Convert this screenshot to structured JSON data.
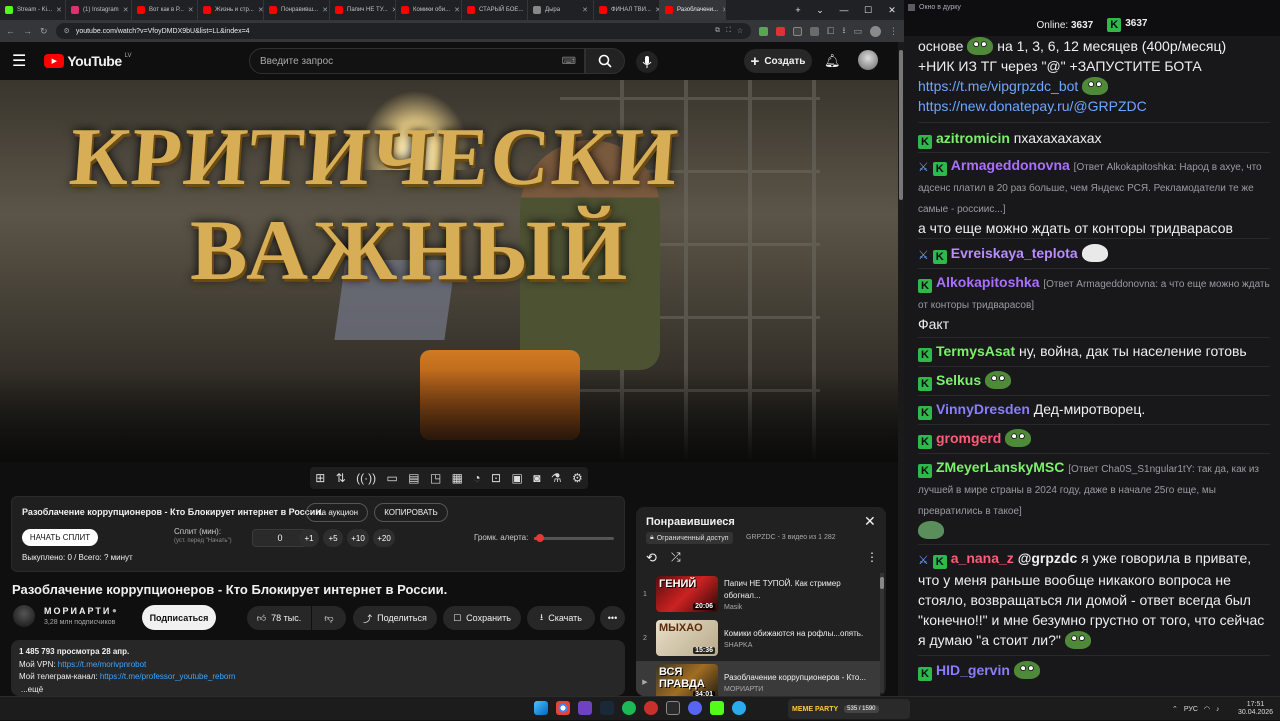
{
  "browser": {
    "tabs": [
      {
        "label": "Stream - Ki...",
        "color": "#53fc18"
      },
      {
        "label": "(1) Instagram",
        "color": "#e1306c"
      },
      {
        "label": "Вот как в Р...",
        "color": "#ff0000"
      },
      {
        "label": "Жизнь и стр...",
        "color": "#ff0000"
      },
      {
        "label": "Понравивш...",
        "color": "#ff0000"
      },
      {
        "label": "Папич НЕ ТУ...",
        "color": "#ff0000"
      },
      {
        "label": "Комики оби...",
        "color": "#ff0000"
      },
      {
        "label": "СТАРЫЙ БОЕ...",
        "color": "#ff0000"
      },
      {
        "label": "Дыра",
        "color": "#888888"
      },
      {
        "label": "ФИНАЛ ТВИ...",
        "color": "#ff0000"
      },
      {
        "label": "Разоблачени...",
        "color": "#ff0000",
        "active": true
      }
    ],
    "url": "youtube.com/watch?v=VfoyDMDX9bU&list=LL&index=4"
  },
  "youtube": {
    "logo": "YouTube",
    "region": "LV",
    "search_placeholder": "Введите запрос",
    "create_label": "Создать",
    "video_overlay_line1": "КРИТИЧЕСКИ",
    "video_overlay_line2": "ВАЖНЫЙ",
    "ext": {
      "title": "Разоблачение коррупционеров - Кто Блокирует интернет в России.",
      "auction_label": "На аукцион",
      "copy_label": "КОПИРОВАТЬ",
      "start_split_label": "НАЧАТЬ СПЛИТ",
      "split_label": "Сплит (мин):",
      "split_hint": "(уст. перед \"Начать\")",
      "split_value": "0",
      "inc": [
        "+1",
        "+5",
        "+10",
        "+20"
      ],
      "alert_volume_label": "Громк. алерта:",
      "alert_volume": 0.07,
      "bought_label": "Выкуплено: 0 / Всего: ? минут"
    },
    "video": {
      "title": "Разоблачение коррупционеров - Кто Блокирует интернет в России.",
      "channel": "МОРИАРТИ",
      "subs": "3,28 млн подписчиков",
      "subscribe_label": "Подписаться",
      "likes": "78 тыс.",
      "share_label": "Поделиться",
      "save_label": "Сохранить",
      "download_label": "Скачать",
      "views_date": "1 485 793 просмотра  28 апр.",
      "vpn_label": "Мой VPN: ",
      "vpn_link": "https://t.me/morivpnrobot",
      "tg_label": "Мой телеграм-канал: ",
      "tg_link": "https://t.me/professor_youtube_reborn",
      "more_label": "...ещё"
    },
    "playlist": {
      "title": "Понравившиеся",
      "access": "Ограниченный доступ",
      "meta": "GRPZDC - 3 видео из 1 282",
      "items": [
        {
          "num": "1",
          "title": "Папич НЕ ТУПОЙ. Как стример обогнал...",
          "channel": "Masik",
          "duration": "20:06",
          "thumb_text": "ГЕНИЙ"
        },
        {
          "num": "2",
          "title": "Комики обижаются на рофлы...опять.",
          "channel": "SHAPKA",
          "duration": "15:36",
          "thumb_text": "МЫХАО"
        },
        {
          "num": "▶",
          "title": "Разоблачение коррупционеров - Кто...",
          "channel": "МОРИАРТИ",
          "duration": "34:01",
          "thumb_text": "ВСЯ ПРАВДА"
        }
      ]
    }
  },
  "chat": {
    "window_title": "Окно в дурку",
    "online_label": "Online:",
    "online_count": "3637",
    "viewers": "3637",
    "messages": [
      {
        "text": "основе",
        "text2": "на 1, 3, 6, 12 месяцев (400р/месяц)",
        "text3": "+НИК ИЗ ТГ через \"@\" +ЗАПУСТИТЕ БОТА",
        "link1": "https://t.me/vipgrpzdc_bot",
        "link2": "https://new.donatepay.ru/@GRPZDC"
      },
      {
        "nick": "azitromicin",
        "color": "#7cf06b",
        "text": "пхахахахахах"
      },
      {
        "nick": "Armageddonovna",
        "color": "#a970ff",
        "reply": "[Ответ Alkokapitoshka: Народ в ахуе, что адсенс платил в 20 раз больше, чем Яндекс РСЯ. Рекламодатели те же самые - россиис...]",
        "text": "а что еще можно ждать от конторы тридварасов"
      },
      {
        "nick": "Evreiskaya_teplota",
        "color": "#b98cff"
      },
      {
        "nick": "Alkokapitoshka",
        "color": "#a970ff",
        "reply": "[Ответ Armageddonovna: а что еще можно ждать от конторы тридварасов]",
        "text": "Факт"
      },
      {
        "nick": "TermysAsat",
        "color": "#7cf06b",
        "text": "ну, война, дак ты население готовь"
      },
      {
        "nick": "Selkus",
        "color": "#7cf06b"
      },
      {
        "nick": "VinnyDresden",
        "color": "#8a7dff",
        "text": "Дед-миротворец."
      },
      {
        "nick": "gromgerd",
        "color": "#ff5c7a"
      },
      {
        "nick": "ZMeyerLanskyMSC",
        "color": "#7cf06b",
        "reply": "[Ответ Cha0S_S1ngular1tY: так да, как из лучшей в мире страны в 2024 году, даже в начале 25го еще, мы превратились в такое]"
      },
      {
        "nick": "a_nana_z",
        "color": "#ff5c7a",
        "mention": "@grpzdc",
        "text": "я уже говорила в привате, что у меня раньше вообще никакого вопроса не стояло, возвращаться ли домой - ответ всегда был \"конечно!!\" и мне безумно грустно от того, что сейчас я думаю \"а стоит ли?\""
      },
      {
        "nick": "HID_gervin",
        "color": "#8a7dff"
      }
    ]
  },
  "taskbar": {
    "stream_widget": "MEME PARTY",
    "stream_count": "535 / 1590",
    "lang": "РУС",
    "time": "17:51",
    "date": "30.04.2026"
  }
}
